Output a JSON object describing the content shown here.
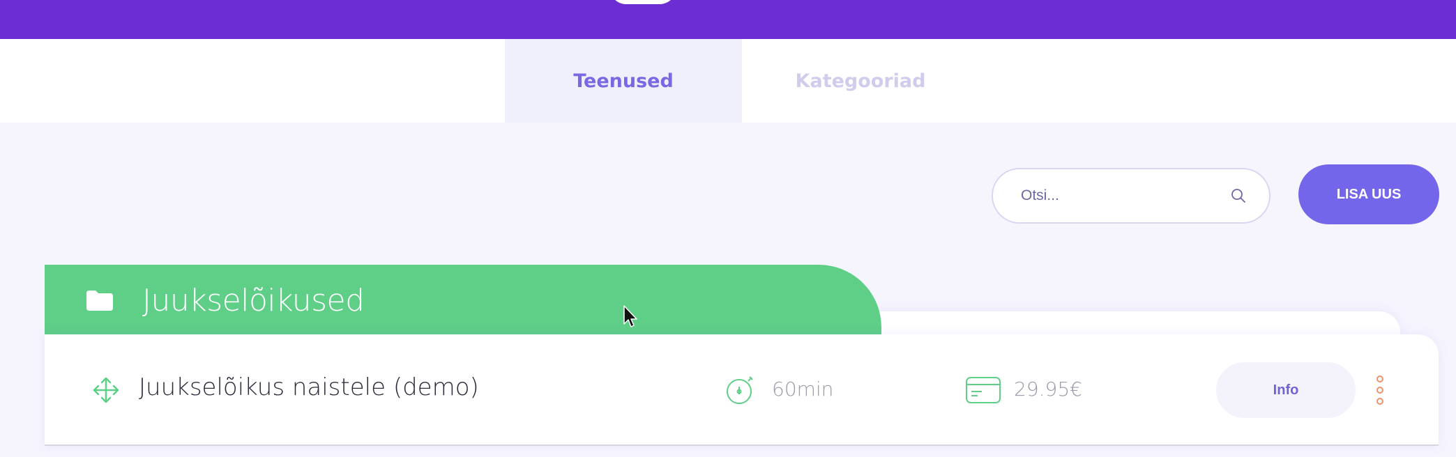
{
  "tabs": [
    {
      "label": "Teenused",
      "active": true
    },
    {
      "label": "Kategooriad",
      "active": false
    }
  ],
  "search": {
    "placeholder": "Otsi...",
    "value": "",
    "icon": "search-icon"
  },
  "actions": {
    "add_new_label": "LISA UUS"
  },
  "category": {
    "title": "Juukselõikused",
    "icon": "folder-icon",
    "color": "#5fcf88"
  },
  "services": [
    {
      "name": "Juukselõikus naistele (demo)",
      "duration": "60min",
      "price": "29.95€",
      "info_label": "Info"
    }
  ],
  "colors": {
    "topbar": "#6c2ed2",
    "accent": "#7466ea",
    "active_tab_text": "#7a68e3",
    "inactive_tab_text": "#d0ccec",
    "category_green": "#5fcf88",
    "more_dots": "#e8956a"
  }
}
